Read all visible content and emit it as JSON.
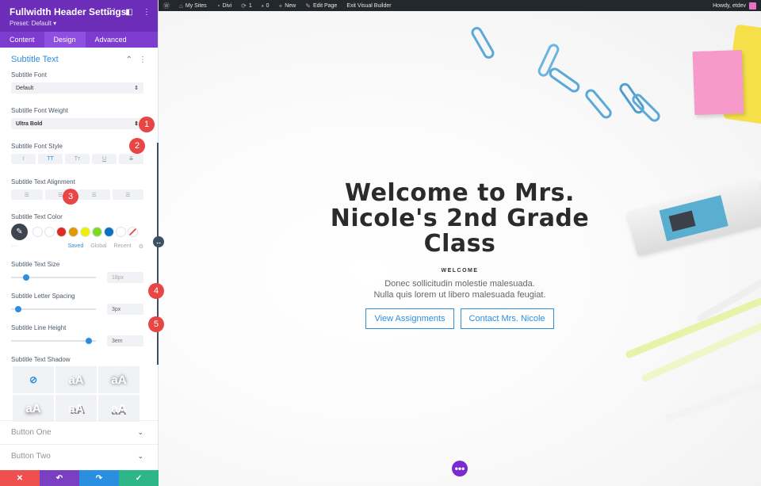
{
  "panel": {
    "title": "Fullwidth Header Settings",
    "preset": "Preset: Default ▾",
    "tabs": [
      "Content",
      "Design",
      "Advanced"
    ],
    "section_title": "Subtitle Text",
    "font_label": "Subtitle Font",
    "font_value": "Default",
    "weight_label": "Subtitle Font Weight",
    "weight_value": "Ultra Bold",
    "style_label": "Subtitle Font Style",
    "style_options": [
      "I",
      "TT",
      "Tт",
      "U",
      "S"
    ],
    "align_label": "Subtitle Text Alignment",
    "color_label": "Subtitle Text Color",
    "swatches": [
      "#ffffff",
      "#ffffff",
      "#e02b20",
      "#e09900",
      "#edf000",
      "#7cda24",
      "#0c71c3",
      "#ffffff"
    ],
    "color_tabs": {
      "saved": "Saved",
      "global": "Global",
      "recent": "Recent"
    },
    "size_label": "Subtitle Text Size",
    "size_value": "18px",
    "size_level": 0.15,
    "spacing_label": "Subtitle Letter Spacing",
    "spacing_value": "3px",
    "spacing_level": 0.05,
    "lineheight_label": "Subtitle Line Height",
    "lineheight_value": "3em",
    "lineheight_level": 0.95,
    "shadow_label": "Subtitle Text Shadow",
    "shadow_sample": "aA",
    "button_one": "Button One",
    "button_two": "Button Two"
  },
  "badges": [
    "1",
    "2",
    "3",
    "4",
    "5"
  ],
  "adminbar": {
    "my_sites": "My Sites",
    "divi": "Divi",
    "updates": "1",
    "comments": "0",
    "new": "New",
    "edit_page": "Edit Page",
    "exit": "Exit Visual Builder",
    "howdy": "Howdy, etdev"
  },
  "hero": {
    "title": "Welcome to Mrs. Nicole's 2nd Grade Class",
    "subtitle": "WELCOME",
    "body_line1": "Donec sollicitudin molestie malesuada.",
    "body_line2": "Nulla quis lorem ut libero malesuada feugiat.",
    "button1": "View Assignments",
    "button2": "Contact Mrs. Nicole"
  },
  "colors": {
    "purple": "#6c2eb9",
    "accent_blue": "#2d8ee0",
    "badge_red": "#e84545",
    "footer": [
      "#ef4f4f",
      "#7b3fc4",
      "#2a8fe0",
      "#2db789"
    ]
  }
}
